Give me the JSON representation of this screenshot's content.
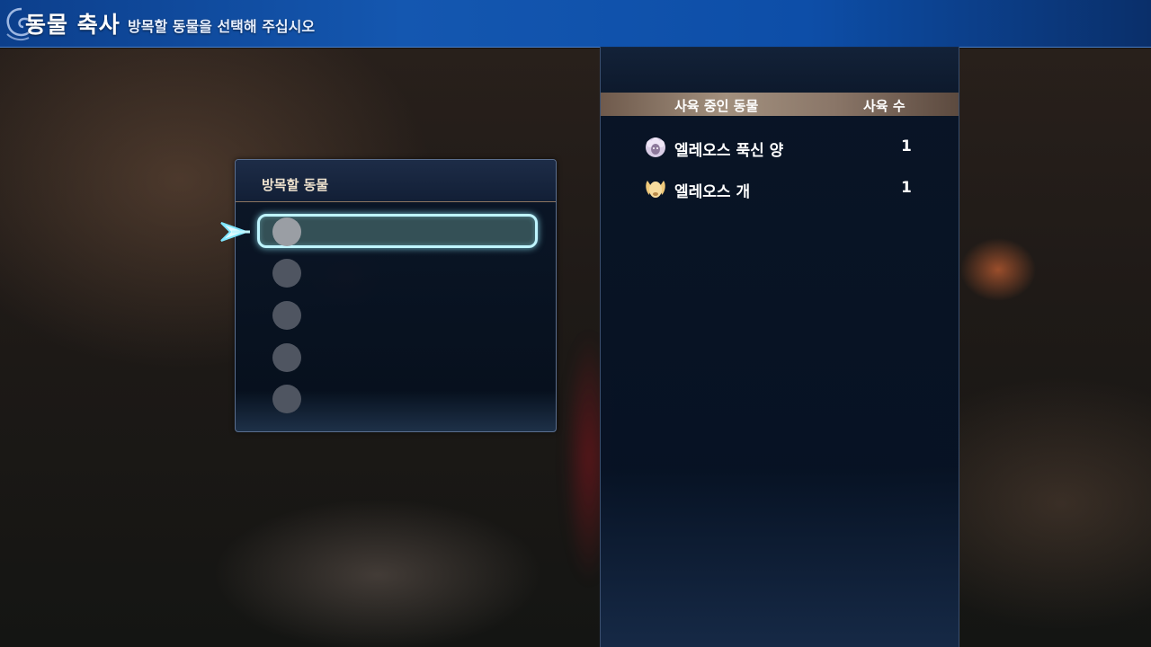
{
  "header": {
    "title": "동물 축사",
    "subtitle": "방목할 동물을 선택해 주십시오",
    "ornament_icon": "swirl-ornament-icon"
  },
  "release_panel": {
    "title": "방목할 동물",
    "selected_index": 0,
    "cursor_icon": "arrow-cursor-icon",
    "slots": [
      {
        "slot_icon": "empty-slot-circle"
      },
      {
        "slot_icon": "empty-slot-circle"
      },
      {
        "slot_icon": "empty-slot-circle"
      },
      {
        "slot_icon": "empty-slot-circle"
      },
      {
        "slot_icon": "empty-slot-circle"
      }
    ]
  },
  "owned_panel": {
    "column_name": "사육 중인 동물",
    "column_count": "사육 수",
    "animals": [
      {
        "name": "엘레오스 푹신 양",
        "count": "1",
        "icon": "sheep-icon",
        "icon_color": "#d9cde6"
      },
      {
        "name": "엘레오스 개",
        "count": "1",
        "icon": "dog-icon",
        "icon_color": "#f0c97a"
      }
    ]
  },
  "colors": {
    "header_blue": "#1457b0",
    "highlight_cyan": "#bff5ff",
    "panel_navy": "#0a1628",
    "column_header_tan": "#a2907e"
  }
}
